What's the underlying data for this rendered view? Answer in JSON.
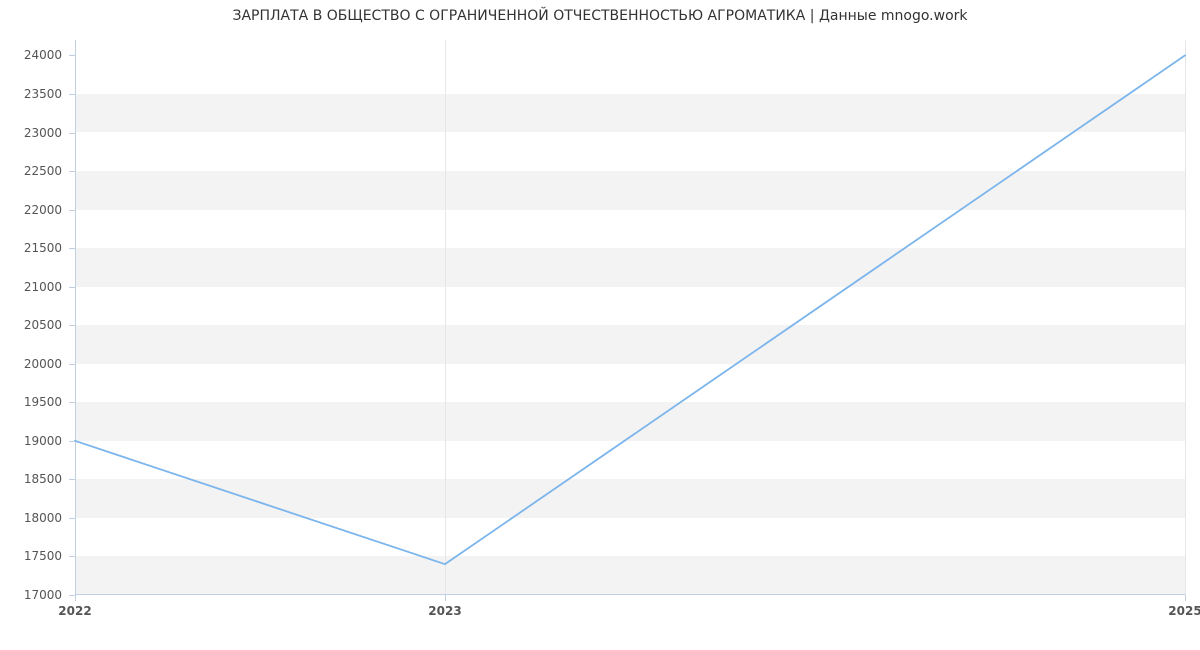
{
  "chart_data": {
    "type": "line",
    "title": "ЗАРПЛАТА В ОБЩЕСТВО С ОГРАНИЧЕННОЙ ОТЧЕСТВЕННОСТЬЮ АГРОМАТИКА | Данные mnogo.work",
    "xlabel": "",
    "ylabel": "",
    "x_ticks": [
      "2022",
      "2023",
      "2025"
    ],
    "y_ticks": [
      17000,
      17500,
      18000,
      18500,
      19000,
      19500,
      20000,
      20500,
      21000,
      21500,
      22000,
      22500,
      23000,
      23500,
      24000
    ],
    "ylim": [
      17000,
      24200
    ],
    "x": [
      2022,
      2023,
      2025
    ],
    "values": [
      19000,
      17400,
      24000
    ],
    "colors": {
      "line": "#7cb5ec",
      "band": "#f3f3f3"
    }
  }
}
